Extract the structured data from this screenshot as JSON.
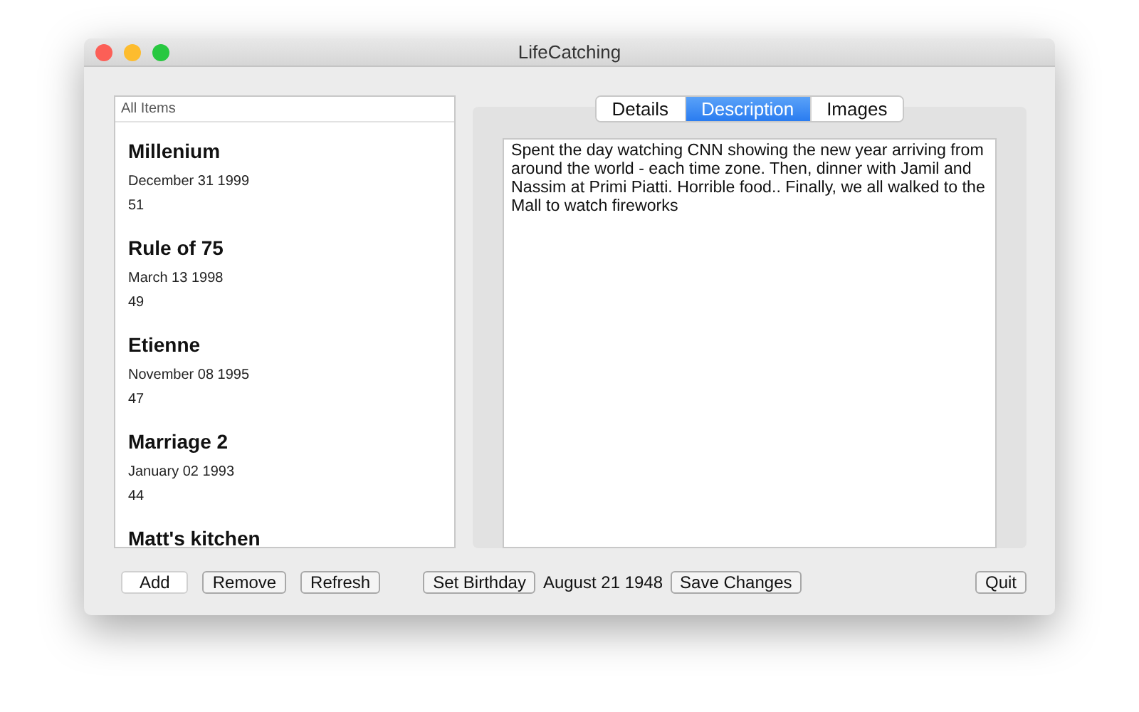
{
  "window": {
    "title": "LifeCatching"
  },
  "list": {
    "header": "All Items",
    "items": [
      {
        "title": "Millenium",
        "date": "December 31 1999",
        "number": "51"
      },
      {
        "title": "Rule of 75",
        "date": "March 13 1998",
        "number": "49"
      },
      {
        "title": "Etienne",
        "date": "November 08 1995",
        "number": "47"
      },
      {
        "title": "Marriage 2",
        "date": "January 02 1993",
        "number": "44"
      },
      {
        "title": "Matt's kitchen"
      }
    ]
  },
  "tabs": [
    {
      "label": "Details",
      "selected": false
    },
    {
      "label": "Description",
      "selected": true
    },
    {
      "label": "Images",
      "selected": false
    }
  ],
  "description": "Spent the day watching CNN showing the new year arriving from around the world - each time zone. Then, dinner with Jamil and Nassim at Primi Piatti. Horrible food.. Finally, we all walked to the Mall to watch fireworks",
  "toolbar": [
    {
      "kind": "button",
      "label": "Add",
      "default": true
    },
    {
      "kind": "button",
      "label": "Remove",
      "default": false
    },
    {
      "kind": "button",
      "label": "Refresh",
      "default": false
    },
    {
      "kind": "gap"
    },
    {
      "kind": "button",
      "label": "Set Birthday",
      "default": false
    },
    {
      "kind": "text",
      "label": "August 21 1948"
    },
    {
      "kind": "button",
      "label": "Save Changes",
      "default": false
    },
    {
      "kind": "spacer"
    },
    {
      "kind": "button",
      "label": "Quit",
      "default": false
    }
  ]
}
